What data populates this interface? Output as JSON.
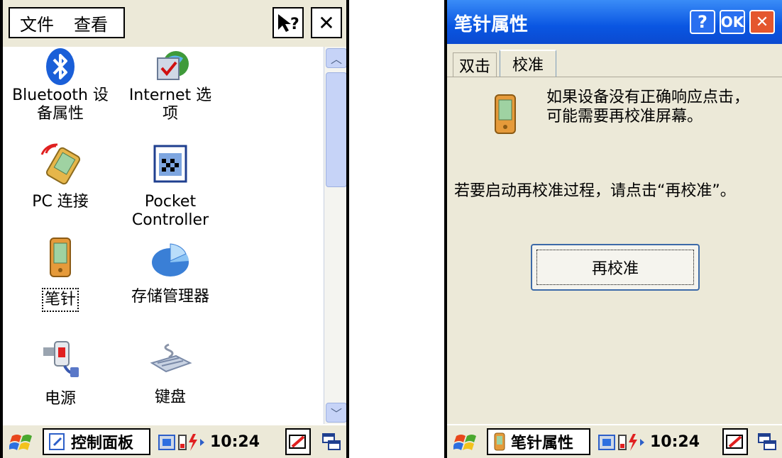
{
  "left": {
    "menu": {
      "file": "文件",
      "view": "查看"
    },
    "items": [
      {
        "label": "Bluetooth 设\n备属性",
        "icon": "bluetooth-icon"
      },
      {
        "label": "Internet 选\n项",
        "icon": "internet-options-icon"
      },
      {
        "label": "PC 连接",
        "icon": "pc-connection-icon"
      },
      {
        "label": "Pocket\nController",
        "icon": "pocket-controller-icon"
      },
      {
        "label": "笔针",
        "icon": "stylus-icon"
      },
      {
        "label": "存储管理器",
        "icon": "storage-manager-icon"
      },
      {
        "label": "电源",
        "icon": "power-icon"
      },
      {
        "label": "键盘",
        "icon": "keyboard-icon"
      }
    ],
    "taskbar": {
      "task": "控制面板",
      "time": "10:24"
    }
  },
  "right": {
    "title": "笔针属性",
    "buttons": {
      "help": "?",
      "ok": "OK",
      "close": "✕"
    },
    "tabs": [
      "双击",
      "校准"
    ],
    "message1": "如果设备没有正确响应点击，\n可能需要再校准屏幕。",
    "message2": "若要启动再校准过程，请点击“再校准”。",
    "recalibrate": "再校准",
    "taskbar": {
      "task": "笔针属性",
      "time": "10:24"
    }
  }
}
